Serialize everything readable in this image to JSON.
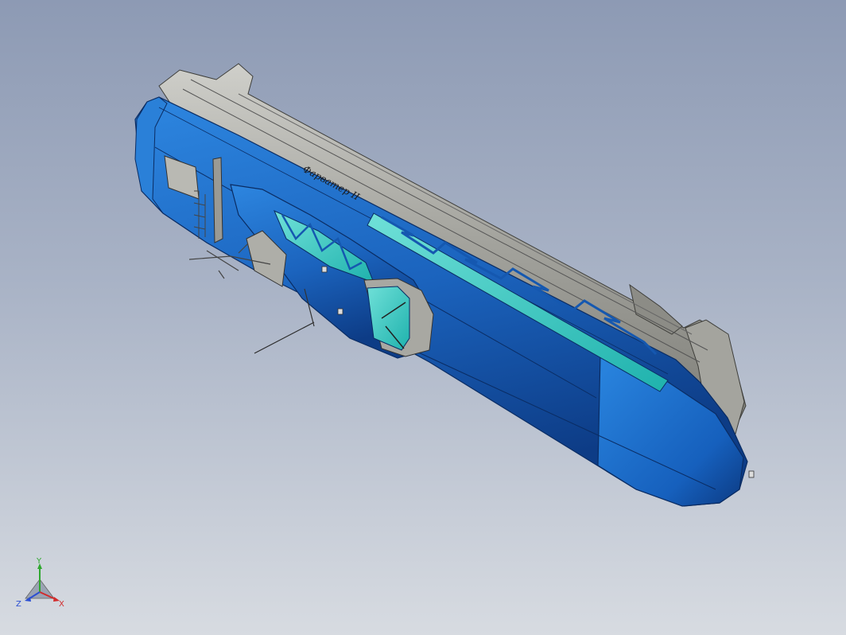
{
  "viewport": {
    "background_top": "#8d9ab4",
    "background_bottom": "#d7dbe1"
  },
  "model": {
    "body_color": "#1f6fc7",
    "body_dark": "#0f3f86",
    "frame_color": "#9c9c96",
    "glass_color": "#3cc9c2",
    "hull_label": "Фарватер II"
  },
  "triad": {
    "y_label": "Y",
    "x_label": "X",
    "z_label": "Z",
    "y_color": "#2fa82f",
    "x_color": "#d22b2b",
    "z_color": "#2b4fd2"
  }
}
